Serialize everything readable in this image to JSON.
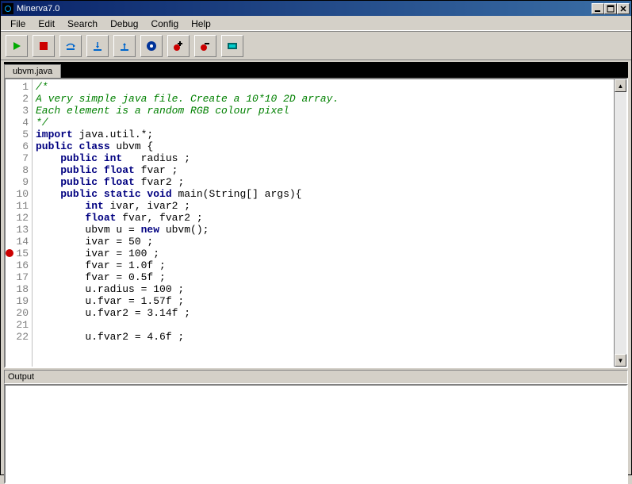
{
  "window": {
    "title": "Minerva7.0"
  },
  "menu": {
    "items": [
      "File",
      "Edit",
      "Search",
      "Debug",
      "Config",
      "Help"
    ]
  },
  "toolbar": {
    "buttons": [
      "run",
      "stop",
      "step-over",
      "step-into",
      "step-out",
      "record",
      "breakpoint-add",
      "breakpoint-remove",
      "watch"
    ]
  },
  "editor": {
    "tab": "ubvm.java",
    "breakpoint_lines": [
      15
    ],
    "lines": [
      {
        "n": 1,
        "tokens": [
          {
            "t": "comment",
            "v": "/*"
          }
        ]
      },
      {
        "n": 2,
        "tokens": [
          {
            "t": "comment",
            "v": "A very simple java file. Create a 10*10 2D array."
          }
        ]
      },
      {
        "n": 3,
        "tokens": [
          {
            "t": "comment",
            "v": "Each element is a random RGB colour pixel"
          }
        ]
      },
      {
        "n": 4,
        "tokens": [
          {
            "t": "comment",
            "v": "*/"
          }
        ]
      },
      {
        "n": 5,
        "tokens": [
          {
            "t": "keyword",
            "v": "import"
          },
          {
            "t": "text",
            "v": " java.util.*;"
          }
        ]
      },
      {
        "n": 6,
        "tokens": [
          {
            "t": "keyword",
            "v": "public class"
          },
          {
            "t": "text",
            "v": " ubvm {"
          }
        ]
      },
      {
        "n": 7,
        "tokens": [
          {
            "t": "text",
            "v": "    "
          },
          {
            "t": "keyword",
            "v": "public int"
          },
          {
            "t": "text",
            "v": "   radius ;"
          }
        ]
      },
      {
        "n": 8,
        "tokens": [
          {
            "t": "text",
            "v": "    "
          },
          {
            "t": "keyword",
            "v": "public float"
          },
          {
            "t": "text",
            "v": " fvar ;"
          }
        ]
      },
      {
        "n": 9,
        "tokens": [
          {
            "t": "text",
            "v": "    "
          },
          {
            "t": "keyword",
            "v": "public float"
          },
          {
            "t": "text",
            "v": " fvar2 ;"
          }
        ]
      },
      {
        "n": 10,
        "tokens": [
          {
            "t": "text",
            "v": "    "
          },
          {
            "t": "keyword",
            "v": "public static void"
          },
          {
            "t": "text",
            "v": " main(String[] args){"
          }
        ]
      },
      {
        "n": 11,
        "tokens": [
          {
            "t": "text",
            "v": "        "
          },
          {
            "t": "keyword",
            "v": "int"
          },
          {
            "t": "text",
            "v": " ivar, ivar2 ;"
          }
        ]
      },
      {
        "n": 12,
        "tokens": [
          {
            "t": "text",
            "v": "        "
          },
          {
            "t": "keyword",
            "v": "float"
          },
          {
            "t": "text",
            "v": " fvar, fvar2 ;"
          }
        ]
      },
      {
        "n": 13,
        "tokens": [
          {
            "t": "text",
            "v": "        ubvm u = "
          },
          {
            "t": "keyword",
            "v": "new"
          },
          {
            "t": "text",
            "v": " ubvm();"
          }
        ]
      },
      {
        "n": 14,
        "tokens": [
          {
            "t": "text",
            "v": "        ivar = 50 ;"
          }
        ]
      },
      {
        "n": 15,
        "tokens": [
          {
            "t": "text",
            "v": "        ivar = 100 ;"
          }
        ]
      },
      {
        "n": 16,
        "tokens": [
          {
            "t": "text",
            "v": "        fvar = 1.0f ;"
          }
        ]
      },
      {
        "n": 17,
        "tokens": [
          {
            "t": "text",
            "v": "        fvar = 0.5f ;"
          }
        ]
      },
      {
        "n": 18,
        "tokens": [
          {
            "t": "text",
            "v": "        u.radius = 100 ;"
          }
        ]
      },
      {
        "n": 19,
        "tokens": [
          {
            "t": "text",
            "v": "        u.fvar = 1.57f ;"
          }
        ]
      },
      {
        "n": 20,
        "tokens": [
          {
            "t": "text",
            "v": "        u.fvar2 = 3.14f ;"
          }
        ]
      },
      {
        "n": 21,
        "tokens": [
          {
            "t": "text",
            "v": ""
          }
        ]
      },
      {
        "n": 22,
        "tokens": [
          {
            "t": "text",
            "v": "        u.fvar2 = 4.6f ;"
          }
        ]
      }
    ]
  },
  "output": {
    "label": "Output",
    "content": ""
  }
}
